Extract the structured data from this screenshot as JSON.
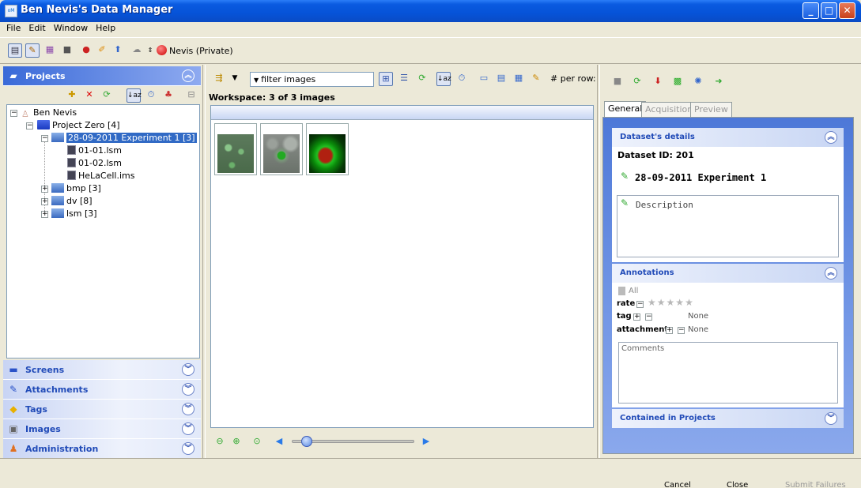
{
  "window": {
    "title": "Ben Nevis's Data Manager",
    "app_icon": "omero-icon"
  },
  "menu": [
    "File",
    "Edit",
    "Window",
    "Help"
  ],
  "toolbar": {
    "group_label": "Nevis (Private)"
  },
  "left": {
    "projects_header": "Projects",
    "tree": {
      "root": "Ben Nevis",
      "project": "Project Zero [4]",
      "dataset": "28-09-2011 Experiment 1 [3]",
      "images": [
        "01-01.lsm",
        "01-02.lsm",
        "HeLaCell.ims"
      ],
      "datasets_other": [
        "bmp [3]",
        "dv [8]",
        "lsm [3]"
      ]
    },
    "sections": [
      "Screens",
      "Attachments",
      "Tags",
      "Images",
      "Administration"
    ]
  },
  "middle": {
    "filter_placeholder": "filter  images",
    "per_row_label": "# per row:",
    "workspace_label": "Workspace: 3 of 3 images"
  },
  "right": {
    "tabs": [
      "General",
      "Acquisition",
      "Preview"
    ],
    "details_header": "Dataset's details",
    "dataset_id": "Dataset ID: 201",
    "dataset_name": "28-09-2011 Experiment 1",
    "description_placeholder": "Description",
    "annotations_header": "Annotations",
    "all_label": "All",
    "rate_label": "rate",
    "tag_label": "tag",
    "tag_value": "None",
    "attachment_label": "attachment",
    "attachment_value": "None",
    "comments_placeholder": "Comments",
    "contained_header": "Contained in Projects"
  },
  "footer_buttons": [
    "Cancel",
    "Close",
    "Submit Failures"
  ],
  "colors": {
    "title_blue": "#0653d8",
    "selection": "#316ac5",
    "header_text": "#214bb8"
  }
}
